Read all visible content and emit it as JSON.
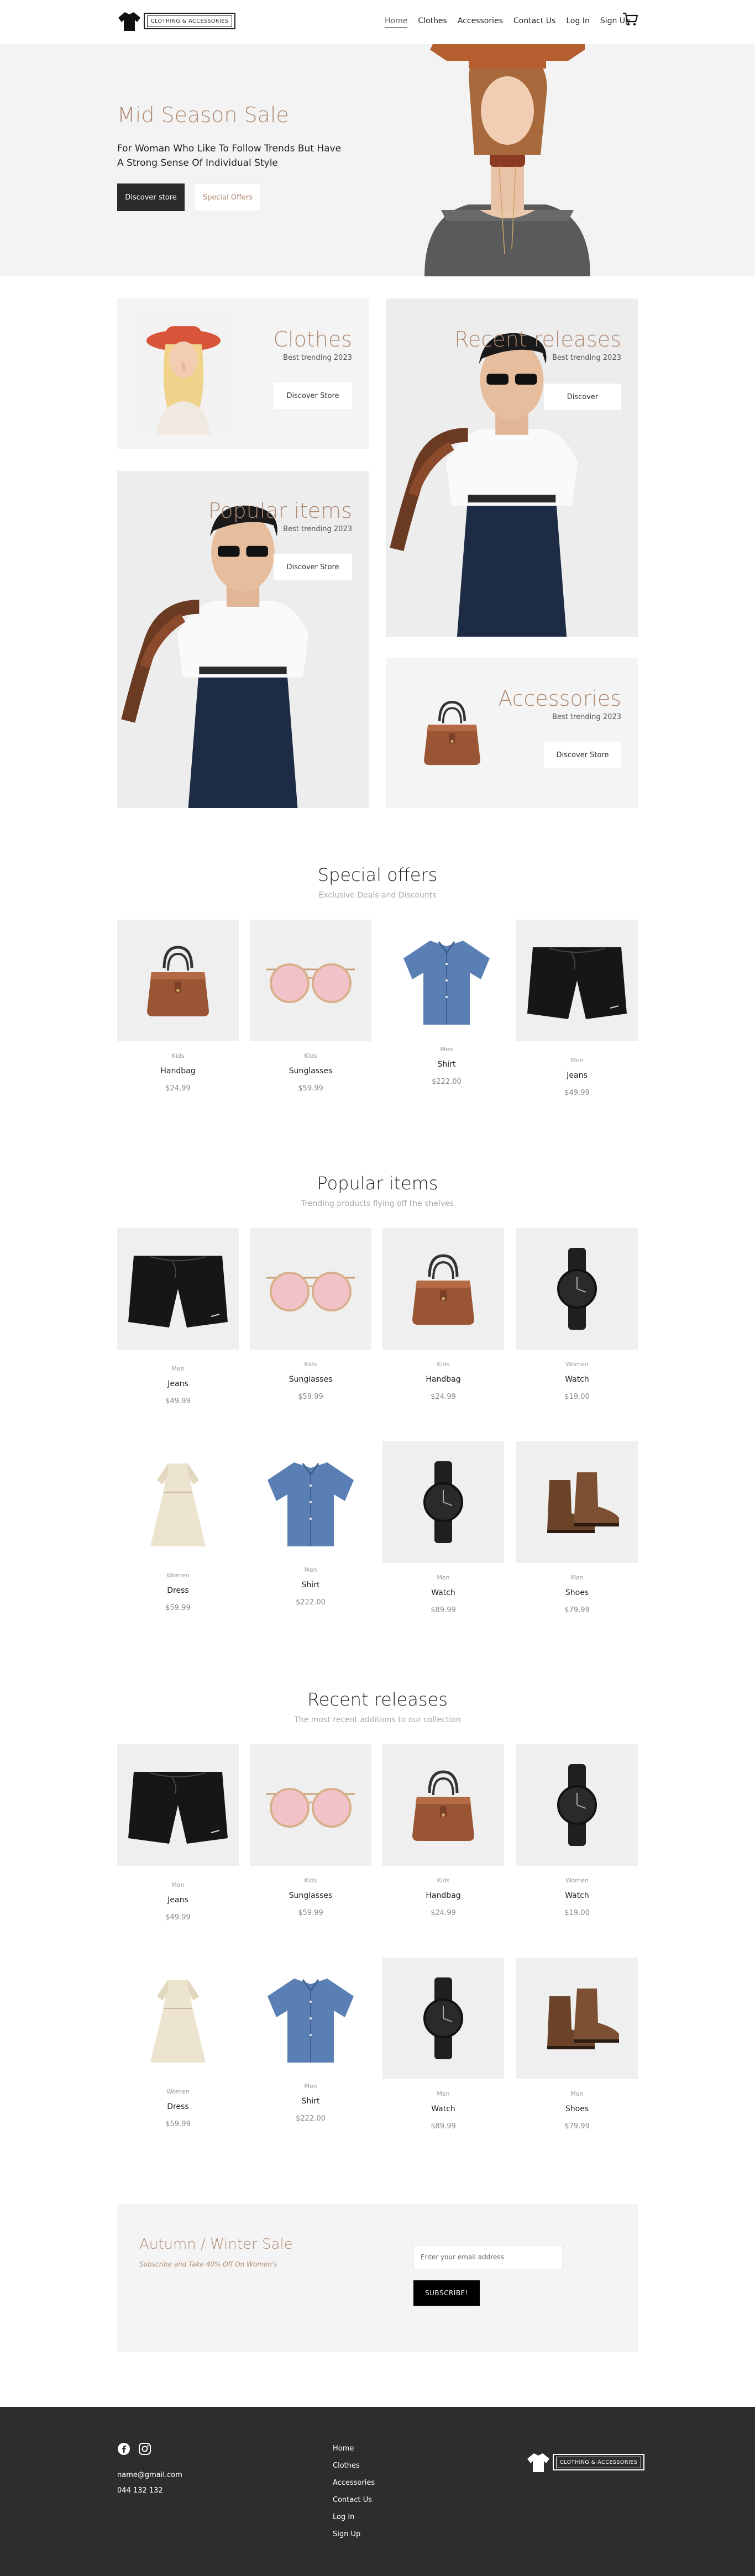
{
  "brand": {
    "logo_text": "CLOTHING & ACCESSORIES"
  },
  "nav": [
    {
      "label": "Home"
    },
    {
      "label": "Clothes"
    },
    {
      "label": "Accessories"
    },
    {
      "label": "Contact Us"
    },
    {
      "label": "Log In"
    },
    {
      "label": "Sign Up"
    }
  ],
  "hero": {
    "title": "Mid Season Sale",
    "subtitle": "For Woman Who Like To Follow Trends But Have A Strong Sense Of Individual Style",
    "btn_primary": "Discover store",
    "btn_secondary": "Special Offers"
  },
  "tiles": {
    "clothes": {
      "title": "Clothes",
      "sub": "Best trending 2023",
      "btn": "Discover Store"
    },
    "recent": {
      "title": "Recent releases",
      "sub": "Best trending 2023",
      "btn": "Discover"
    },
    "popular": {
      "title": "Popular items",
      "sub": "Best trending 2023",
      "btn": "Discover Store"
    },
    "accessories": {
      "title": "Accessories",
      "sub": "Best trending 2023",
      "btn": "Discover Store"
    }
  },
  "special": {
    "title": "Special offers",
    "subtitle": "Exclusive Deals and Discounts",
    "items": [
      {
        "cat": "Kids",
        "name": "Handbag",
        "price": "$24.99"
      },
      {
        "cat": "Kids",
        "name": "Sunglasses",
        "price": "$59.99"
      },
      {
        "cat": "Men",
        "name": "Shirt",
        "price": "$222.00"
      },
      {
        "cat": "Men",
        "name": "Jeans",
        "price": "$49.99"
      }
    ]
  },
  "popular": {
    "title": "Popular items",
    "subtitle": "Trending products flying off the shelves",
    "items": [
      {
        "cat": "Men",
        "name": "Jeans",
        "price": "$49.99"
      },
      {
        "cat": "Kids",
        "name": "Sunglasses",
        "price": "$59.99"
      },
      {
        "cat": "Kids",
        "name": "Handbag",
        "price": "$24.99"
      },
      {
        "cat": "Women",
        "name": "Watch",
        "price": "$19.00"
      },
      {
        "cat": "Women",
        "name": "Dress",
        "price": "$59.99"
      },
      {
        "cat": "Men",
        "name": "Shirt",
        "price": "$222.00"
      },
      {
        "cat": "Men",
        "name": "Watch",
        "price": "$89.99"
      },
      {
        "cat": "Men",
        "name": "Shoes",
        "price": "$79.99"
      }
    ]
  },
  "recent": {
    "title": "Recent releases",
    "subtitle": "The most recent additions to our collection",
    "items": [
      {
        "cat": "Men",
        "name": "Jeans",
        "price": "$49.99"
      },
      {
        "cat": "Kids",
        "name": "Sunglasses",
        "price": "$59.99"
      },
      {
        "cat": "Kids",
        "name": "Handbag",
        "price": "$24.99"
      },
      {
        "cat": "Women",
        "name": "Watch",
        "price": "$19.00"
      },
      {
        "cat": "Women",
        "name": "Dress",
        "price": "$59.99"
      },
      {
        "cat": "Men",
        "name": "Shirt",
        "price": "$222.00"
      },
      {
        "cat": "Men",
        "name": "Watch",
        "price": "$89.99"
      },
      {
        "cat": "Men",
        "name": "Shoes",
        "price": "$79.99"
      }
    ]
  },
  "newsletter": {
    "title": "Autumn / Winter Sale",
    "subtitle": "Subscribe and Take 40% Off On Women's",
    "placeholder": "Enter your email address",
    "button": "SUBSCRIBE!"
  },
  "footer": {
    "email": "name@gmail.com",
    "phone": "044 132 132",
    "links": [
      {
        "label": "Home"
      },
      {
        "label": "Clothes"
      },
      {
        "label": "Accessories"
      },
      {
        "label": "Contact Us"
      },
      {
        "label": "Log In"
      },
      {
        "label": "Sign Up"
      }
    ]
  },
  "colors": {
    "accent": "#b08a72",
    "dark": "#2d2d2d",
    "tile_bg": "#f4f4f4"
  }
}
